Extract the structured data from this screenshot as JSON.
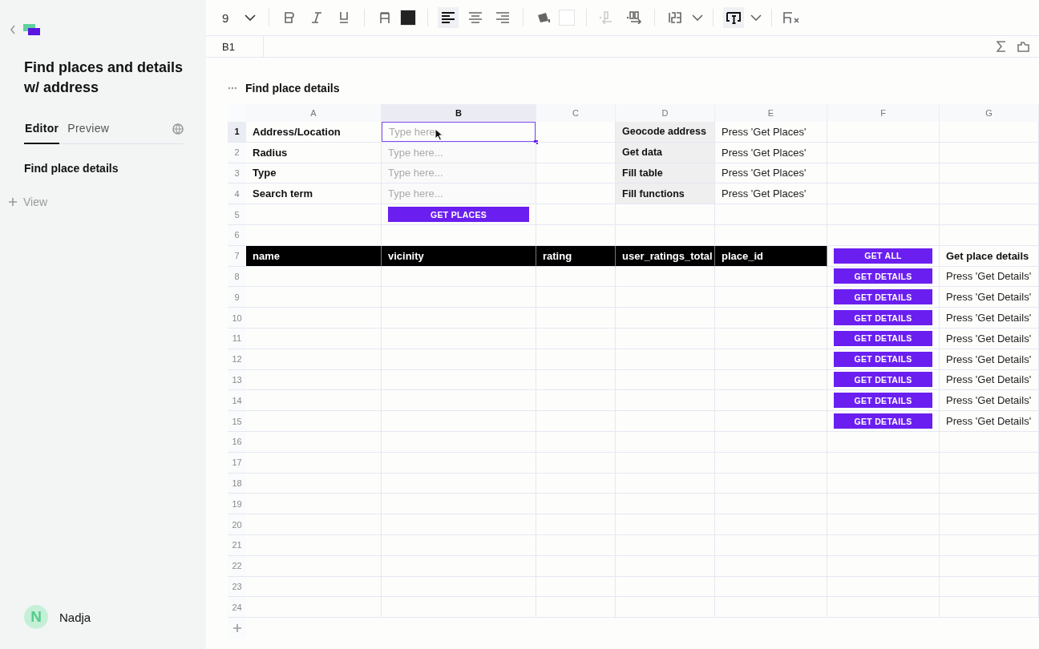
{
  "sidebar": {
    "title": "Find places and details w/ address",
    "tabs": [
      {
        "label": "Editor",
        "selected": true
      },
      {
        "label": "Preview",
        "selected": false
      }
    ],
    "pages": [
      {
        "label": "Find place details",
        "selected": true
      }
    ],
    "add_view": "View",
    "user": {
      "initial": "N",
      "name": "Nadja"
    }
  },
  "toolbar": {
    "items": [
      {
        "kind": "font-size",
        "value": "9"
      },
      {
        "kind": "divider"
      },
      {
        "kind": "bold",
        "active": false,
        "disabled": false
      },
      {
        "kind": "italic",
        "active": false,
        "disabled": false
      },
      {
        "kind": "underline",
        "active": false,
        "disabled": false
      },
      {
        "kind": "divider"
      },
      {
        "kind": "text-color",
        "active": false,
        "disabled": false
      },
      {
        "kind": "swatch",
        "color": "#222222"
      },
      {
        "kind": "divider"
      },
      {
        "kind": "align-left",
        "active": true,
        "disabled": false
      },
      {
        "kind": "align-center",
        "active": false,
        "disabled": false
      },
      {
        "kind": "align-right",
        "active": false,
        "disabled": false
      },
      {
        "kind": "divider"
      },
      {
        "kind": "fill-color",
        "active": false,
        "disabled": false
      },
      {
        "kind": "swatch",
        "color": "#ffffff"
      },
      {
        "kind": "divider"
      },
      {
        "kind": "decrease-decimals",
        "active": false,
        "disabled": true
      },
      {
        "kind": "increase-decimals",
        "active": false,
        "disabled": false
      },
      {
        "kind": "divider"
      },
      {
        "kind": "number-format",
        "active": false,
        "disabled": false
      },
      {
        "kind": "divider"
      },
      {
        "kind": "wrap",
        "active": true,
        "disabled": false
      },
      {
        "kind": "divider"
      },
      {
        "kind": "clear-format",
        "active": false,
        "disabled": false
      }
    ]
  },
  "formula_bar": {
    "cell_ref": "B1"
  },
  "sheet": {
    "title": "Find place details",
    "columns": [
      {
        "label": "A",
        "selected": false
      },
      {
        "label": "B",
        "selected": true
      },
      {
        "label": "C",
        "selected": false
      },
      {
        "label": "D",
        "selected": false
      },
      {
        "label": "E",
        "selected": false
      },
      {
        "label": "F",
        "selected": false
      },
      {
        "label": "G",
        "selected": false
      }
    ],
    "rows": [
      {
        "number": "1",
        "selected": true,
        "cells": [
          {
            "kind": "label",
            "text": "Address/Location"
          },
          {
            "kind": "input",
            "placeholder": "Type here...",
            "selected": true
          },
          {
            "kind": "empty"
          },
          {
            "kind": "step",
            "text": "Geocode address"
          },
          {
            "kind": "text",
            "text": "Press 'Get Places'"
          },
          {
            "kind": "empty"
          },
          {
            "kind": "empty"
          }
        ]
      },
      {
        "number": "2",
        "selected": false,
        "cells": [
          {
            "kind": "label",
            "text": "Radius"
          },
          {
            "kind": "input",
            "placeholder": "Type here...",
            "selected": false
          },
          {
            "kind": "empty"
          },
          {
            "kind": "step",
            "text": "Get data"
          },
          {
            "kind": "text",
            "text": "Press 'Get Places'"
          },
          {
            "kind": "empty"
          },
          {
            "kind": "empty"
          }
        ]
      },
      {
        "number": "3",
        "selected": false,
        "cells": [
          {
            "kind": "label",
            "text": "Type"
          },
          {
            "kind": "input",
            "placeholder": "Type here...",
            "selected": false
          },
          {
            "kind": "empty"
          },
          {
            "kind": "step",
            "text": "Fill table"
          },
          {
            "kind": "text",
            "text": "Press 'Get Places'"
          },
          {
            "kind": "empty"
          },
          {
            "kind": "empty"
          }
        ]
      },
      {
        "number": "4",
        "selected": false,
        "cells": [
          {
            "kind": "label",
            "text": "Search term"
          },
          {
            "kind": "input",
            "placeholder": "Type here...",
            "selected": false
          },
          {
            "kind": "empty"
          },
          {
            "kind": "step",
            "text": "Fill functions"
          },
          {
            "kind": "text",
            "text": "Press 'Get Places'"
          },
          {
            "kind": "empty"
          },
          {
            "kind": "empty"
          }
        ]
      },
      {
        "number": "5",
        "selected": false,
        "cells": [
          {
            "kind": "empty"
          },
          {
            "kind": "button",
            "text": "GET PLACES"
          },
          {
            "kind": "empty"
          },
          {
            "kind": "empty"
          },
          {
            "kind": "empty"
          },
          {
            "kind": "empty"
          },
          {
            "kind": "empty"
          }
        ]
      },
      {
        "number": "6",
        "selected": false,
        "cells": []
      },
      {
        "number": "7",
        "selected": false,
        "cells": [
          {
            "kind": "header",
            "text": "name"
          },
          {
            "kind": "header",
            "text": "vicinity"
          },
          {
            "kind": "header",
            "text": "rating"
          },
          {
            "kind": "header",
            "text": "user_ratings_total"
          },
          {
            "kind": "header",
            "text": "place_id"
          },
          {
            "kind": "button",
            "text": "GET ALL"
          },
          {
            "kind": "label",
            "text": "Get place details"
          }
        ]
      },
      {
        "number": "8",
        "selected": false,
        "cells": [
          {
            "kind": "empty"
          },
          {
            "kind": "empty"
          },
          {
            "kind": "empty"
          },
          {
            "kind": "empty"
          },
          {
            "kind": "empty"
          },
          {
            "kind": "button",
            "text": "GET DETAILS"
          },
          {
            "kind": "text",
            "text": "Press 'Get Details'"
          }
        ]
      },
      {
        "number": "9",
        "selected": false,
        "cells": [
          {
            "kind": "empty"
          },
          {
            "kind": "empty"
          },
          {
            "kind": "empty"
          },
          {
            "kind": "empty"
          },
          {
            "kind": "empty"
          },
          {
            "kind": "button",
            "text": "GET DETAILS"
          },
          {
            "kind": "text",
            "text": "Press 'Get Details'"
          }
        ]
      },
      {
        "number": "10",
        "selected": false,
        "cells": [
          {
            "kind": "empty"
          },
          {
            "kind": "empty"
          },
          {
            "kind": "empty"
          },
          {
            "kind": "empty"
          },
          {
            "kind": "empty"
          },
          {
            "kind": "button",
            "text": "GET DETAILS"
          },
          {
            "kind": "text",
            "text": "Press 'Get Details'"
          }
        ]
      },
      {
        "number": "11",
        "selected": false,
        "cells": [
          {
            "kind": "empty"
          },
          {
            "kind": "empty"
          },
          {
            "kind": "empty"
          },
          {
            "kind": "empty"
          },
          {
            "kind": "empty"
          },
          {
            "kind": "button",
            "text": "GET DETAILS"
          },
          {
            "kind": "text",
            "text": "Press 'Get Details'"
          }
        ]
      },
      {
        "number": "12",
        "selected": false,
        "cells": [
          {
            "kind": "empty"
          },
          {
            "kind": "empty"
          },
          {
            "kind": "empty"
          },
          {
            "kind": "empty"
          },
          {
            "kind": "empty"
          },
          {
            "kind": "button",
            "text": "GET DETAILS"
          },
          {
            "kind": "text",
            "text": "Press 'Get Details'"
          }
        ]
      },
      {
        "number": "13",
        "selected": false,
        "cells": [
          {
            "kind": "empty"
          },
          {
            "kind": "empty"
          },
          {
            "kind": "empty"
          },
          {
            "kind": "empty"
          },
          {
            "kind": "empty"
          },
          {
            "kind": "button",
            "text": "GET DETAILS"
          },
          {
            "kind": "text",
            "text": "Press 'Get Details'"
          }
        ]
      },
      {
        "number": "14",
        "selected": false,
        "cells": [
          {
            "kind": "empty"
          },
          {
            "kind": "empty"
          },
          {
            "kind": "empty"
          },
          {
            "kind": "empty"
          },
          {
            "kind": "empty"
          },
          {
            "kind": "button",
            "text": "GET DETAILS"
          },
          {
            "kind": "text",
            "text": "Press 'Get Details'"
          }
        ]
      },
      {
        "number": "15",
        "selected": false,
        "cells": [
          {
            "kind": "empty"
          },
          {
            "kind": "empty"
          },
          {
            "kind": "empty"
          },
          {
            "kind": "empty"
          },
          {
            "kind": "empty"
          },
          {
            "kind": "button",
            "text": "GET DETAILS"
          },
          {
            "kind": "text",
            "text": "Press 'Get Details'"
          }
        ]
      },
      {
        "number": "16",
        "selected": false,
        "cells": []
      },
      {
        "number": "17",
        "selected": false,
        "cells": []
      },
      {
        "number": "18",
        "selected": false,
        "cells": []
      },
      {
        "number": "19",
        "selected": false,
        "cells": []
      },
      {
        "number": "20",
        "selected": false,
        "cells": []
      },
      {
        "number": "21",
        "selected": false,
        "cells": []
      },
      {
        "number": "22",
        "selected": false,
        "cells": []
      },
      {
        "number": "23",
        "selected": false,
        "cells": []
      },
      {
        "number": "24",
        "selected": false,
        "cells": []
      }
    ]
  }
}
